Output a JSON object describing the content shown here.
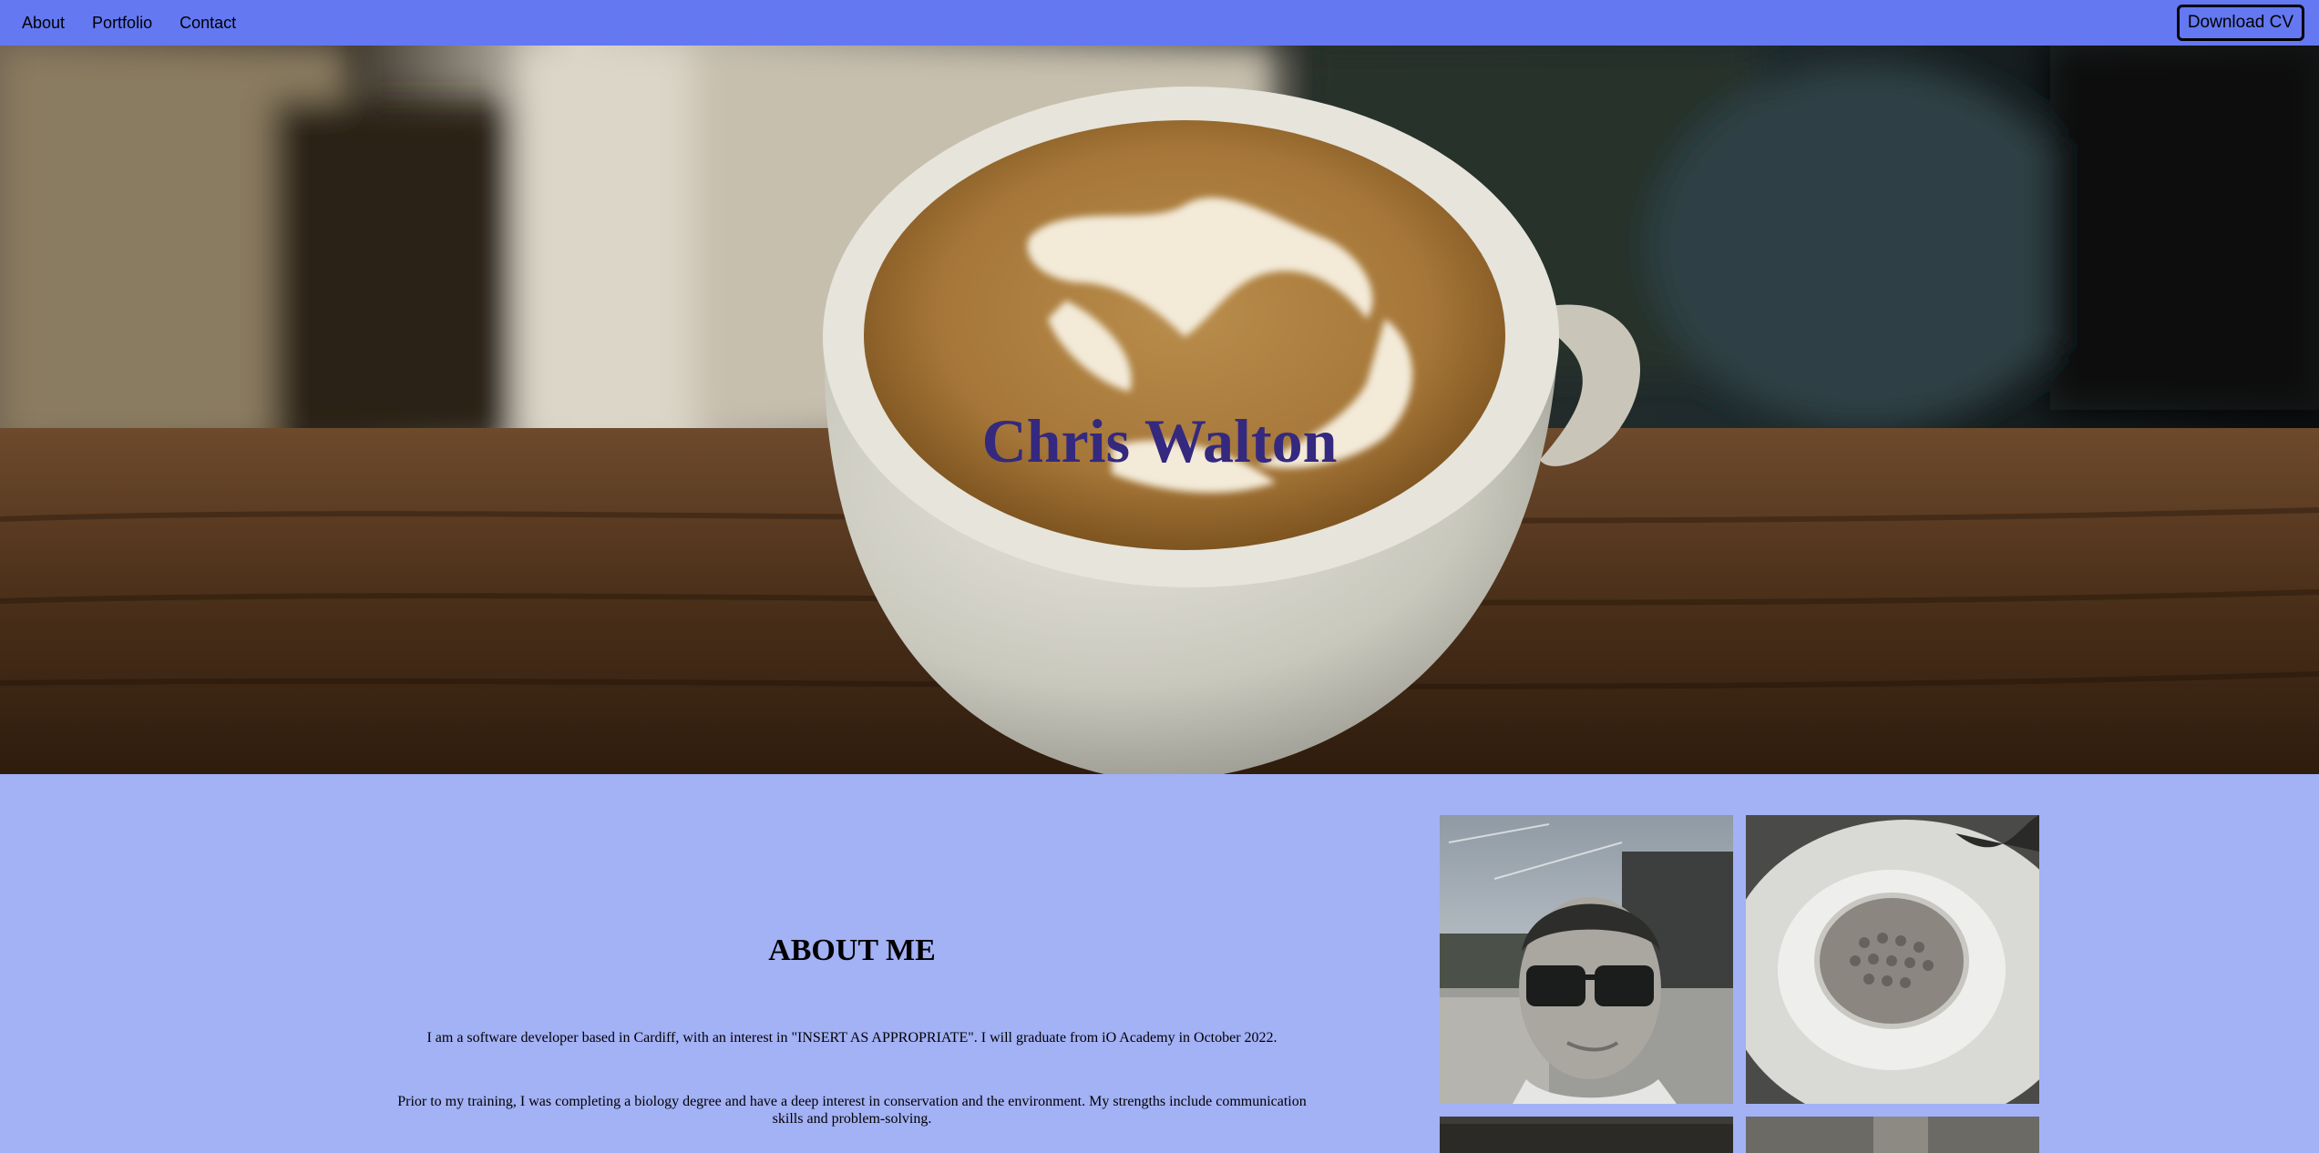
{
  "nav": {
    "links": [
      "About",
      "Portfolio",
      "Contact"
    ],
    "cv_button": "Download CV"
  },
  "hero": {
    "title": "Chris Walton",
    "image": "latte-coffee-cup-photo"
  },
  "about": {
    "heading": "ABOUT ME",
    "paragraph_1": "I am a software developer based in Cardiff, with an interest in \"INSERT AS APPROPRIATE\". I will graduate from iO Academy in October 2022.",
    "paragraph_2": "Prior to my training, I was completing a biology degree and have a deep interest in conservation and the environment. My strengths include communication skills and problem-solving."
  },
  "gallery": [
    "selfie-sunglasses-photo",
    "plated-dish-photo",
    "gallery-photo-3",
    "gallery-photo-4"
  ],
  "colors": {
    "nav_bg": "#6478f2",
    "section_bg": "#a3b1f5",
    "title": "#34297e"
  }
}
